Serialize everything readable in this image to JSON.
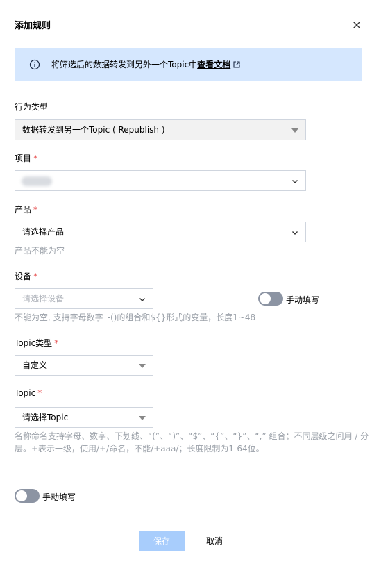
{
  "dialog": {
    "title": "添加规则",
    "close_icon": "close-icon"
  },
  "banner": {
    "icon": "info-icon",
    "text": "将筛选后的数据转发到另外一个Topic中",
    "link": "查看文档",
    "link_icon": "external-link-icon",
    "background": "#d5e7fe"
  },
  "action_type": {
    "label": "行为类型",
    "value": "数据转发到另一个Topic ( Republish )"
  },
  "project": {
    "label": "项目",
    "required": "*",
    "value": ""
  },
  "product": {
    "label": "产品",
    "required": "*",
    "value": "请选择产品",
    "error": "产品不能为空"
  },
  "device": {
    "label": "设备",
    "required": "*",
    "placeholder": "请选择设备",
    "manual_label": "手动填写",
    "hint": "不能为空, 支持字母数字_-()的组合和${}形式的变量，长度1~48"
  },
  "topic_type": {
    "label": "Topic类型",
    "required": "*",
    "value": "自定义"
  },
  "topic": {
    "label": "Topic",
    "required": "*",
    "value": "请选择Topic",
    "hint_line1": "名称命名支持字母、数字、下划线、“(”、“)”、“$”、“{”、“}”、“,” 组合；不同层级之间用 / 分",
    "hint_line2": "层。+表示一级，使用/+/命名，不能/+aaa/；长度限制为1-64位。"
  },
  "bottom_toggle": {
    "label": "手动填写"
  },
  "buttons": {
    "save": "保存",
    "cancel": "取消"
  },
  "colors": {
    "required": "#e54545",
    "save_disabled": "#a8cdfc",
    "toggle_off": "#8c94a3"
  }
}
